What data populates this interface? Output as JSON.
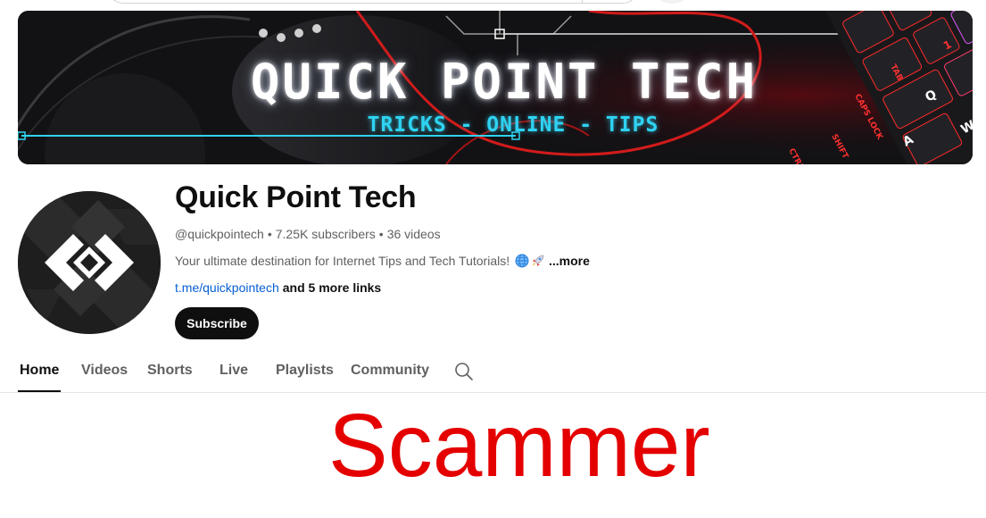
{
  "banner": {
    "title": "QUICK POINT TECH",
    "tagline": "TRICKS - ONLINE - TIPS",
    "keycaps": [
      "TAB",
      "CAPS LOCK",
      "SHIFT",
      "CTRL",
      "Q",
      "A",
      "W",
      "1"
    ]
  },
  "channel": {
    "name": "Quick Point Tech",
    "handle": "@quickpointech",
    "subscribers": "7.25K subscribers",
    "videos": "36 videos",
    "separator": "•",
    "description": "Your ultimate destination for Internet Tips and Tech Tutorials!",
    "description_emojis": [
      "globe-icon",
      "rocket-icon"
    ],
    "more_label": "...more",
    "link_text": "t.me/quickpointech",
    "more_links": "and 5 more links",
    "subscribe_label": "Subscribe"
  },
  "tabs": [
    {
      "label": "Home",
      "active": true
    },
    {
      "label": "Videos",
      "active": false
    },
    {
      "label": "Shorts",
      "active": false
    },
    {
      "label": "Live",
      "active": false
    },
    {
      "label": "Playlists",
      "active": false
    },
    {
      "label": "Community",
      "active": false
    }
  ],
  "overlay_text": "Scammer",
  "colors": {
    "overlay": "#e50000",
    "link": "#065fd4",
    "subscribe_bg": "#0f0f0f",
    "tagline": "#2fd3f2",
    "keyboard_glow": "#ff2a2a"
  }
}
